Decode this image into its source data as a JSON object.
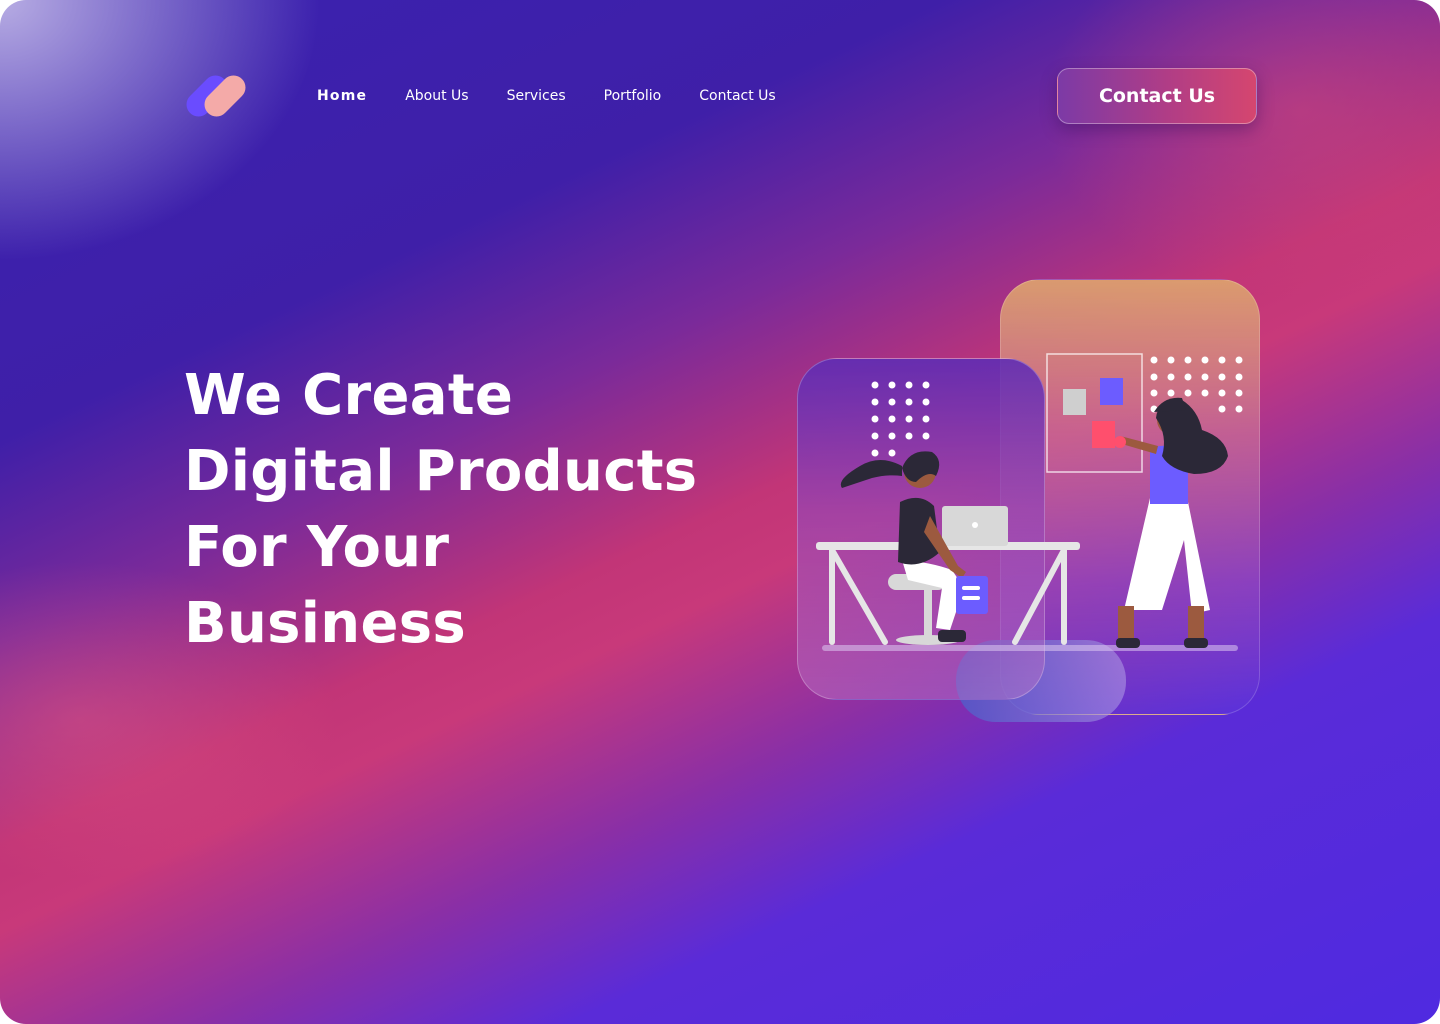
{
  "nav": {
    "items": [
      {
        "label": "Home",
        "active": true
      },
      {
        "label": "About Us"
      },
      {
        "label": "Services"
      },
      {
        "label": "Portfolio"
      },
      {
        "label": "Contact Us"
      }
    ]
  },
  "header": {
    "cta_label": "Contact Us"
  },
  "hero": {
    "lines": [
      "We Create",
      "Digital Products",
      "For Your",
      "Business"
    ]
  },
  "colors": {
    "logo_pill_a": "#6a4cff",
    "logo_pill_b": "#f4aaa8",
    "accent_blue": "#6c5cff",
    "accent_red": "#ff4f6d"
  },
  "icons": [
    "logo-icon"
  ]
}
